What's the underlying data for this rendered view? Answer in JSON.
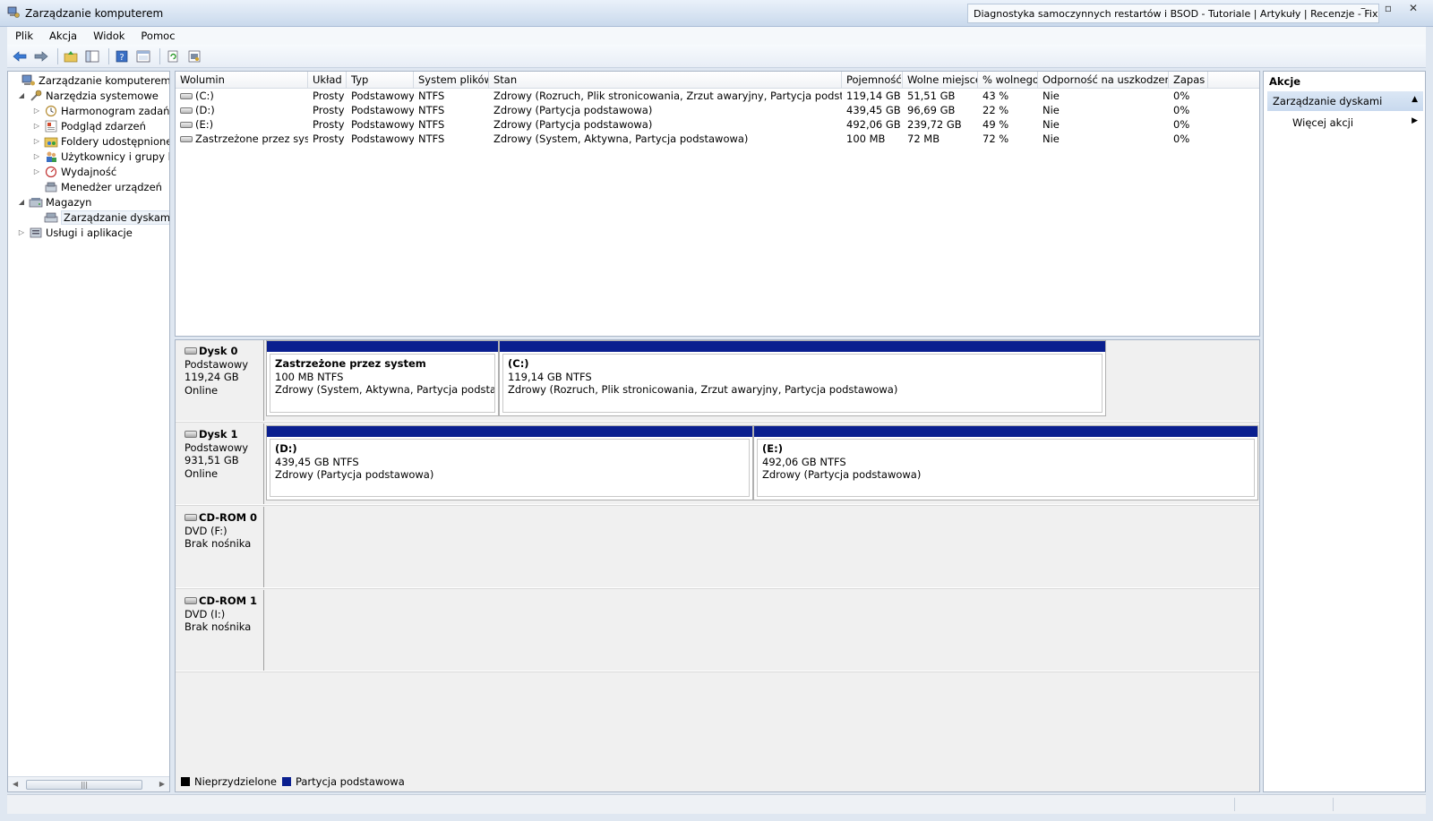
{
  "window": {
    "title": "Zarządzanie komputerem",
    "other_window_title": "Diagnostyka samoczynnych restartów i BSOD - Tutoriale | Artykuły | Recenzje - Fixitpc.pl",
    "buttons": {
      "minimize": "–",
      "maximize": "▫",
      "close": "✕"
    }
  },
  "menu": [
    "Plik",
    "Akcja",
    "Widok",
    "Pomoc"
  ],
  "toolbar_icons": [
    "back-arrow-icon",
    "forward-arrow-icon",
    "up-folder-icon",
    "show-hide-tree-icon",
    "help-icon",
    "properties-icon",
    "refresh-icon",
    "export-icon"
  ],
  "tree": [
    {
      "label": "Zarządzanie komputerem (lokal",
      "level": 0,
      "expander": "",
      "icon": "computer-management-icon"
    },
    {
      "label": "Narzędzia systemowe",
      "level": 1,
      "expander": "◢",
      "icon": "system-tools-icon"
    },
    {
      "label": "Harmonogram zadań",
      "level": 2,
      "expander": "▷",
      "icon": "clock-icon"
    },
    {
      "label": "Podgląd zdarzeń",
      "level": 2,
      "expander": "▷",
      "icon": "event-viewer-icon"
    },
    {
      "label": "Foldery udostępnione",
      "level": 2,
      "expander": "▷",
      "icon": "shared-folder-icon"
    },
    {
      "label": "Użytkownicy i grupy lok",
      "level": 2,
      "expander": "▷",
      "icon": "users-icon"
    },
    {
      "label": "Wydajność",
      "level": 2,
      "expander": "▷",
      "icon": "performance-icon"
    },
    {
      "label": "Menedżer urządzeń",
      "level": 2,
      "expander": "",
      "icon": "device-manager-icon"
    },
    {
      "label": "Magazyn",
      "level": 1,
      "expander": "◢",
      "icon": "storage-icon"
    },
    {
      "label": "Zarządzanie dyskami",
      "level": 2,
      "expander": "",
      "icon": "disk-management-icon",
      "selected": true
    },
    {
      "label": "Usługi i aplikacje",
      "level": 1,
      "expander": "▷",
      "icon": "services-icon"
    }
  ],
  "volume_table": {
    "headers": [
      "Wolumin",
      "Układ",
      "Typ",
      "System plików",
      "Stan",
      "Pojemność",
      "Wolne miejsce",
      "% wolnego",
      "Odporność na uszkodzenia",
      "Zapas"
    ],
    "rows": [
      [
        "(C:)",
        "Prosty",
        "Podstawowy",
        "NTFS",
        "Zdrowy (Rozruch, Plik stronicowania, Zrzut awaryjny, Partycja podstawowa)",
        "119,14 GB",
        "51,51 GB",
        "43 %",
        "Nie",
        "0%"
      ],
      [
        "(D:)",
        "Prosty",
        "Podstawowy",
        "NTFS",
        "Zdrowy (Partycja podstawowa)",
        "439,45 GB",
        "96,69 GB",
        "22 %",
        "Nie",
        "0%"
      ],
      [
        "(E:)",
        "Prosty",
        "Podstawowy",
        "NTFS",
        "Zdrowy (Partycja podstawowa)",
        "492,06 GB",
        "239,72 GB",
        "49 %",
        "Nie",
        "0%"
      ],
      [
        "Zastrzeżone przez system",
        "Prosty",
        "Podstawowy",
        "NTFS",
        "Zdrowy (System, Aktywna, Partycja podstawowa)",
        "100 MB",
        "72 MB",
        "72 %",
        "Nie",
        "0%"
      ]
    ]
  },
  "disks": [
    {
      "name": "Dysk 0",
      "type": "Podstawowy",
      "size": "119,24 GB",
      "status": "Online",
      "icon": "hard-disk-icon",
      "partitions": [
        {
          "title": "Zastrzeżone przez system",
          "size": "100 MB NTFS",
          "status": "Zdrowy (System, Aktywna, Partycja podstawowa)"
        },
        {
          "title": "(C:)",
          "size": "119,14 GB NTFS",
          "status": "Zdrowy (Rozruch, Plik stronicowania, Zrzut awaryjny, Partycja podstawowa)"
        }
      ]
    },
    {
      "name": "Dysk 1",
      "type": "Podstawowy",
      "size": "931,51 GB",
      "status": "Online",
      "icon": "hard-disk-icon",
      "partitions": [
        {
          "title": "(D:)",
          "size": "439,45 GB NTFS",
          "status": "Zdrowy (Partycja podstawowa)"
        },
        {
          "title": "(E:)",
          "size": "492,06 GB NTFS",
          "status": "Zdrowy (Partycja podstawowa)"
        }
      ]
    },
    {
      "name": "CD-ROM 0",
      "type": "DVD (F:)",
      "size": "",
      "status": "Brak nośnika",
      "icon": "cd-rom-icon",
      "partitions": []
    },
    {
      "name": "CD-ROM 1",
      "type": "DVD (I:)",
      "size": "",
      "status": "Brak nośnika",
      "icon": "cd-rom-icon",
      "partitions": []
    }
  ],
  "legend": [
    {
      "label": "Nieprzydzielone",
      "color": "#000000"
    },
    {
      "label": "Partycja podstawowa",
      "color": "#0a1f8f"
    }
  ],
  "actions": {
    "header": "Akcje",
    "section": "Zarządzanie dyskami",
    "more": "Więcej akcji"
  }
}
